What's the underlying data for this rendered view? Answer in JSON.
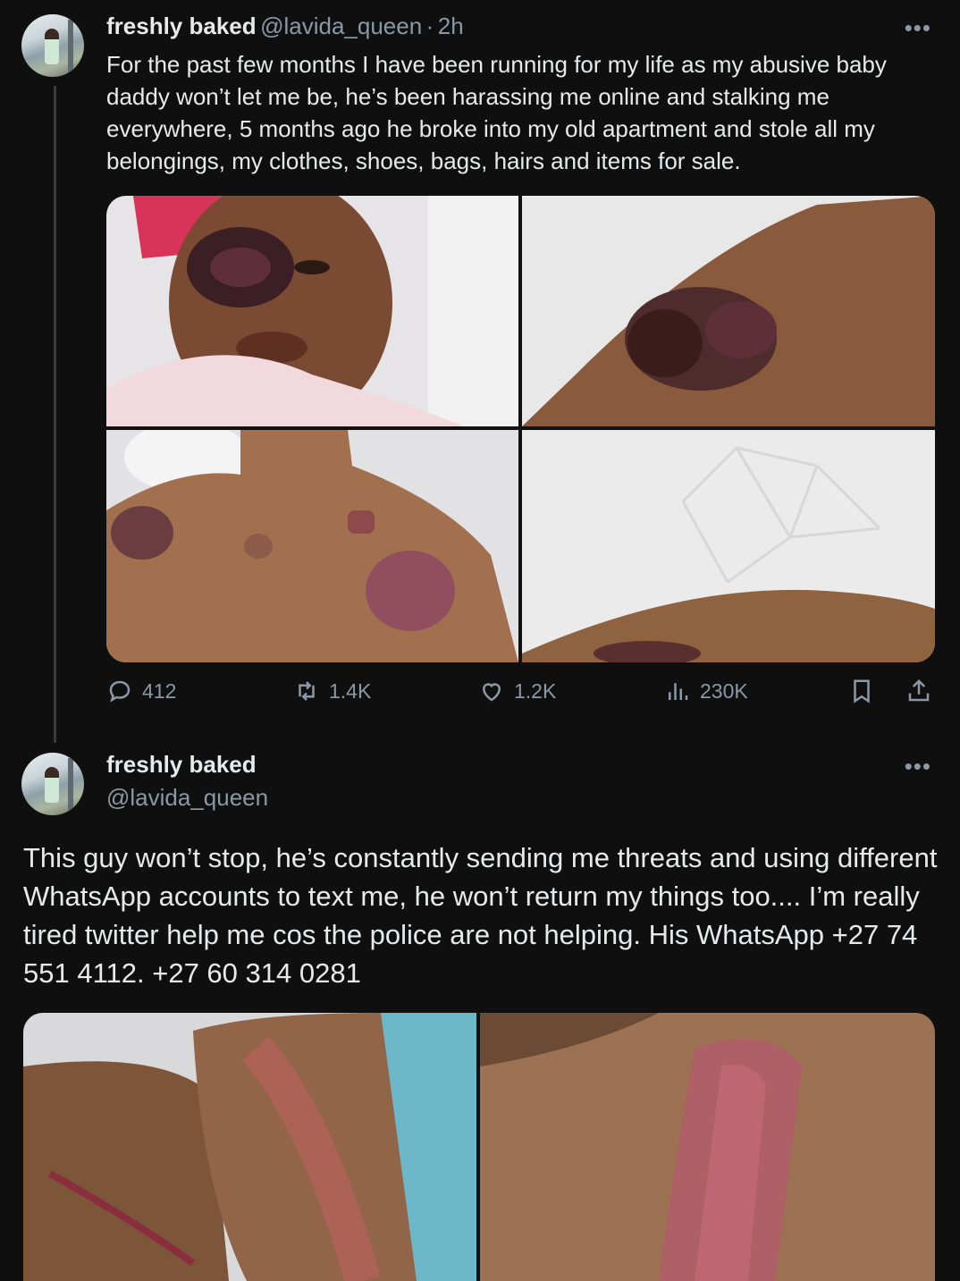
{
  "tweet1": {
    "display_name": "freshly baked",
    "handle": "@lavida_queen",
    "separator": "·",
    "time": "2h",
    "more": "•••",
    "text": "For the past few months I have been running for my life as my abusive baby daddy won’t let me be, he’s been harassing me online and stalking me everywhere, 5 months ago he broke into my old apartment and stole all my belongings, my clothes, shoes, bags, hairs and items for sale.",
    "photos": [
      "photo-face-bruise",
      "photo-arm-bruise",
      "photo-back-bruises",
      "photo-leg-bed"
    ],
    "stats": {
      "replies": "412",
      "reposts": "1.4K",
      "likes": "1.2K",
      "views": "230K"
    }
  },
  "tweet2": {
    "display_name": "freshly baked",
    "handle": "@lavida_queen",
    "more": "•••",
    "text": "This guy won’t stop, he’s constantly sending me threats and using different WhatsApp accounts to text me, he won’t return my things too.... I’m really tired twitter help me cos the police are not helping. His WhatsApp +27 74 551 4112.  +27 60 314 0281",
    "photos": [
      "photo-leg-scratches",
      "photo-thigh-bruise"
    ]
  },
  "icons": {
    "reply": "reply-icon",
    "repost": "repost-icon",
    "like": "heart-icon",
    "views": "views-icon",
    "bookmark": "bookmark-icon",
    "share": "share-icon"
  },
  "colors": {
    "background": "#0f0f0f",
    "text": "#e7e9ea",
    "secondary": "#8b98a5"
  }
}
